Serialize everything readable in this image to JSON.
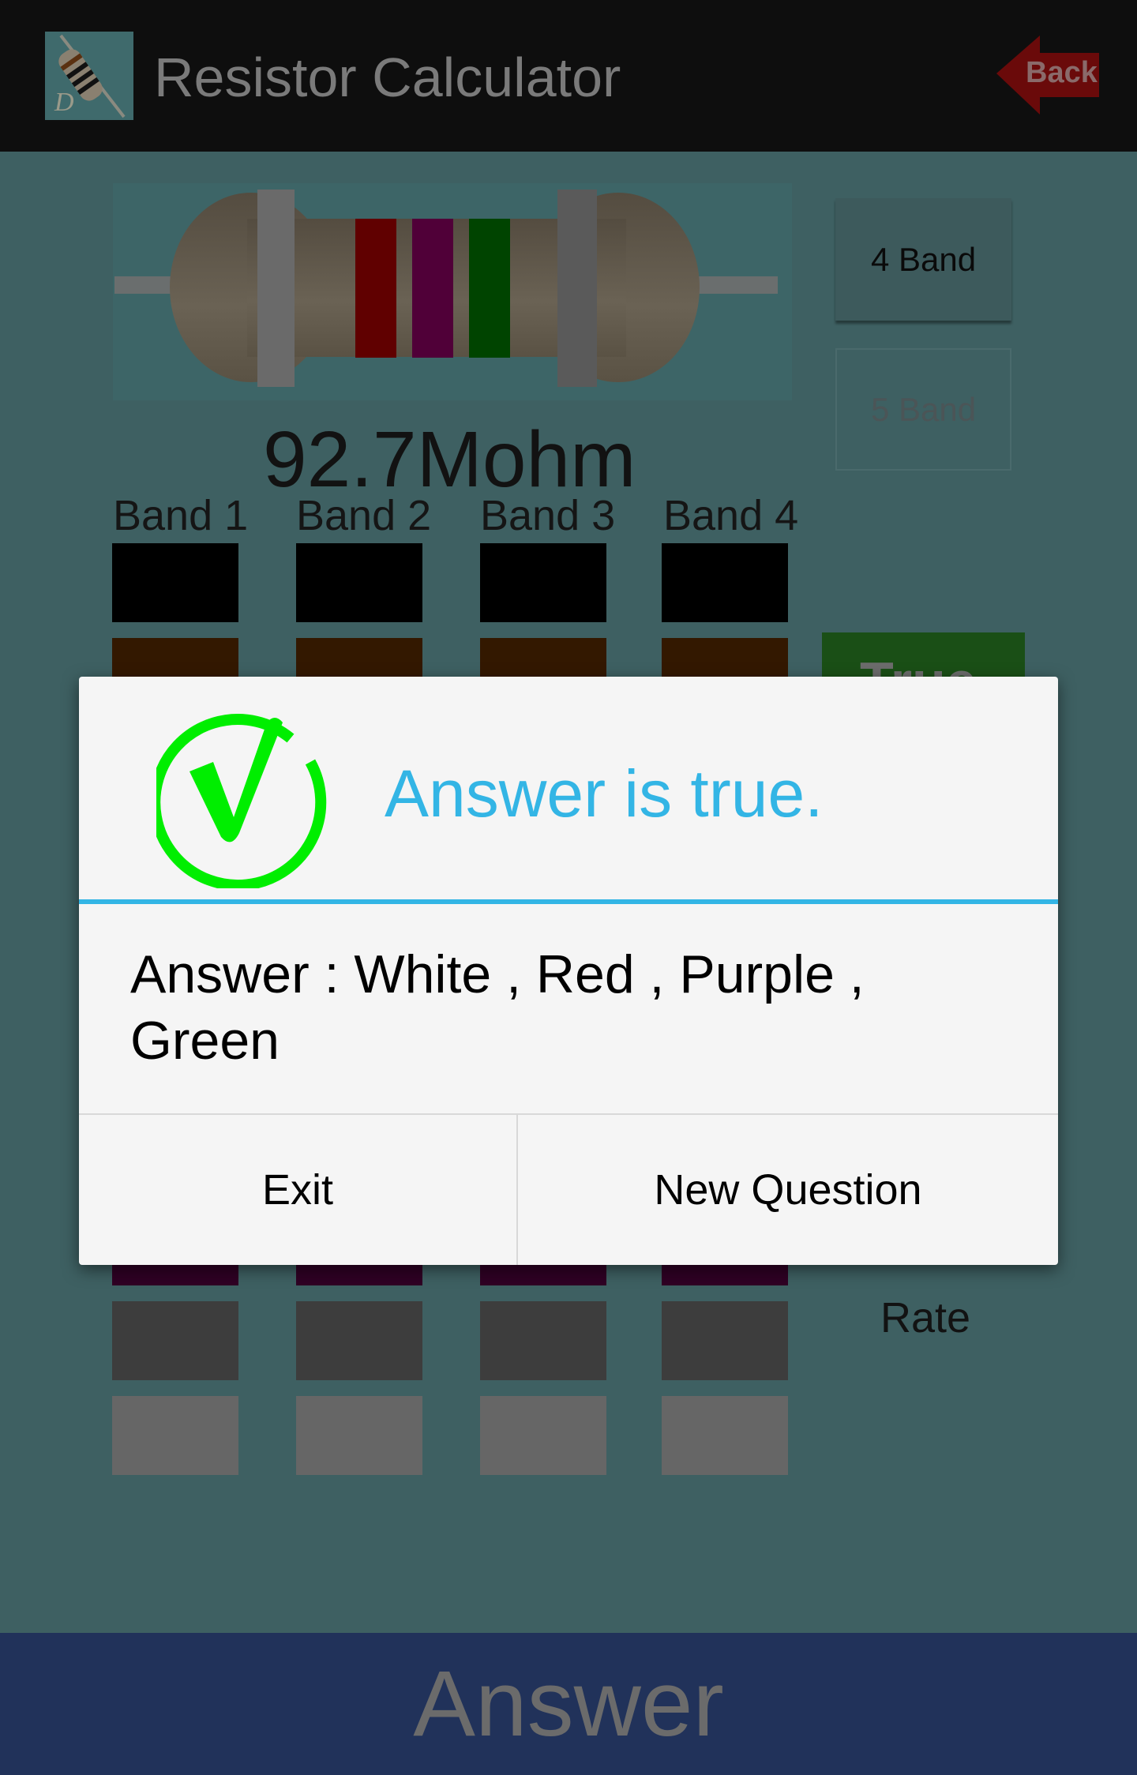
{
  "header": {
    "title": "Resistor Calculator",
    "back_label": "Back",
    "app_icon": "resistor-icon",
    "back_icon": "red-arrow-left-icon"
  },
  "resistor": {
    "bands": [
      "White",
      "Red",
      "Purple",
      "Green"
    ],
    "band_colors": [
      "#6a6a6a",
      "#600000",
      "#500038",
      "#004400"
    ],
    "value": "92.7Mohm"
  },
  "mode_buttons": {
    "four_band": "4 Band",
    "five_band": "5 Band",
    "selected": "4 Band"
  },
  "band_labels": [
    "Band 1",
    "Band 2",
    "Band 3",
    "Band 4"
  ],
  "swatch_colors": [
    "#000000",
    "#331800",
    "#400000",
    "#402000",
    "#404000",
    "#003300",
    "#000040",
    "#2f0024",
    "#3d3d3d",
    "#666666"
  ],
  "side": {
    "true_label": "True",
    "rate_label": "Rate"
  },
  "bottom": {
    "answer_label": "Answer"
  },
  "dialog": {
    "icon": "green-checkmark-icon",
    "title": "Answer is true.",
    "message": "Answer : White , Red , Purple , Green",
    "exit_label": "Exit",
    "new_question_label": "New Question",
    "accent": "#33b5e5"
  }
}
